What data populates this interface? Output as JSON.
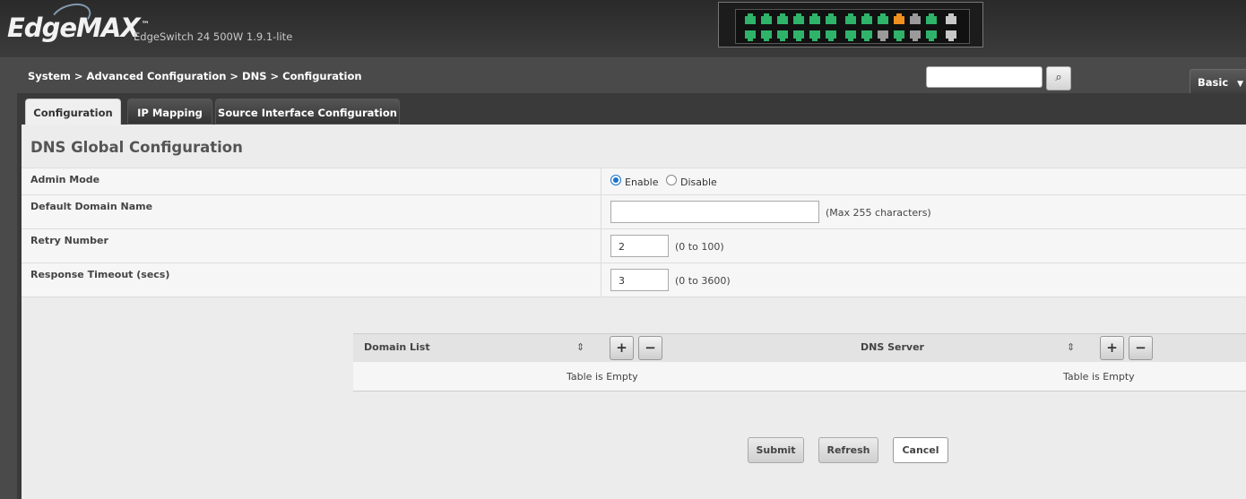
{
  "header": {
    "logo_text": "EdgeMAX",
    "logo_tm": "™",
    "device_name": "EdgeSwitch 24 500W 1.9.1-lite",
    "port_colors": {
      "up": "#2fb36a",
      "warn": "#f0901e",
      "down": "#9a9a9a",
      "sfp": "#c8c8c8"
    },
    "ports_top": [
      "up",
      "up",
      "up",
      "up",
      "up",
      "up",
      "up",
      "up",
      "up",
      "warn",
      "down",
      "up",
      "sfp"
    ],
    "ports_bottom": [
      "up",
      "up",
      "up",
      "up",
      "up",
      "up",
      "up",
      "up",
      "down",
      "up",
      "down",
      "up",
      "sfp"
    ]
  },
  "breadcrumb": "System > Advanced Configuration > DNS > Configuration",
  "search": {
    "icon": "search-icon"
  },
  "mode_select": {
    "value": "Basic"
  },
  "tabs": [
    {
      "label": "Configuration",
      "active": true
    },
    {
      "label": "IP Mapping",
      "active": false
    },
    {
      "label": "Source Interface Configuration",
      "active": false
    }
  ],
  "section_title": "DNS Global Configuration",
  "form": {
    "admin_mode": {
      "label": "Admin Mode",
      "options": [
        "Enable",
        "Disable"
      ],
      "selected": "Enable"
    },
    "default_domain": {
      "label": "Default Domain Name",
      "value": "",
      "hint": "(Max 255 characters)"
    },
    "retry_number": {
      "label": "Retry Number",
      "value": "2",
      "hint": "(0 to 100)"
    },
    "response_timeout": {
      "label": "Response Timeout (secs)",
      "value": "3",
      "hint": "(0 to 3600)"
    }
  },
  "tables": {
    "domain_list": {
      "header": "Domain List",
      "empty_text": "Table is Empty"
    },
    "dns_server": {
      "header": "DNS Server",
      "empty_text": "Table is Empty"
    },
    "add_symbol": "+",
    "remove_symbol": "−",
    "sort_symbol": "⇕"
  },
  "buttons": {
    "submit": "Submit",
    "refresh": "Refresh",
    "cancel": "Cancel"
  }
}
